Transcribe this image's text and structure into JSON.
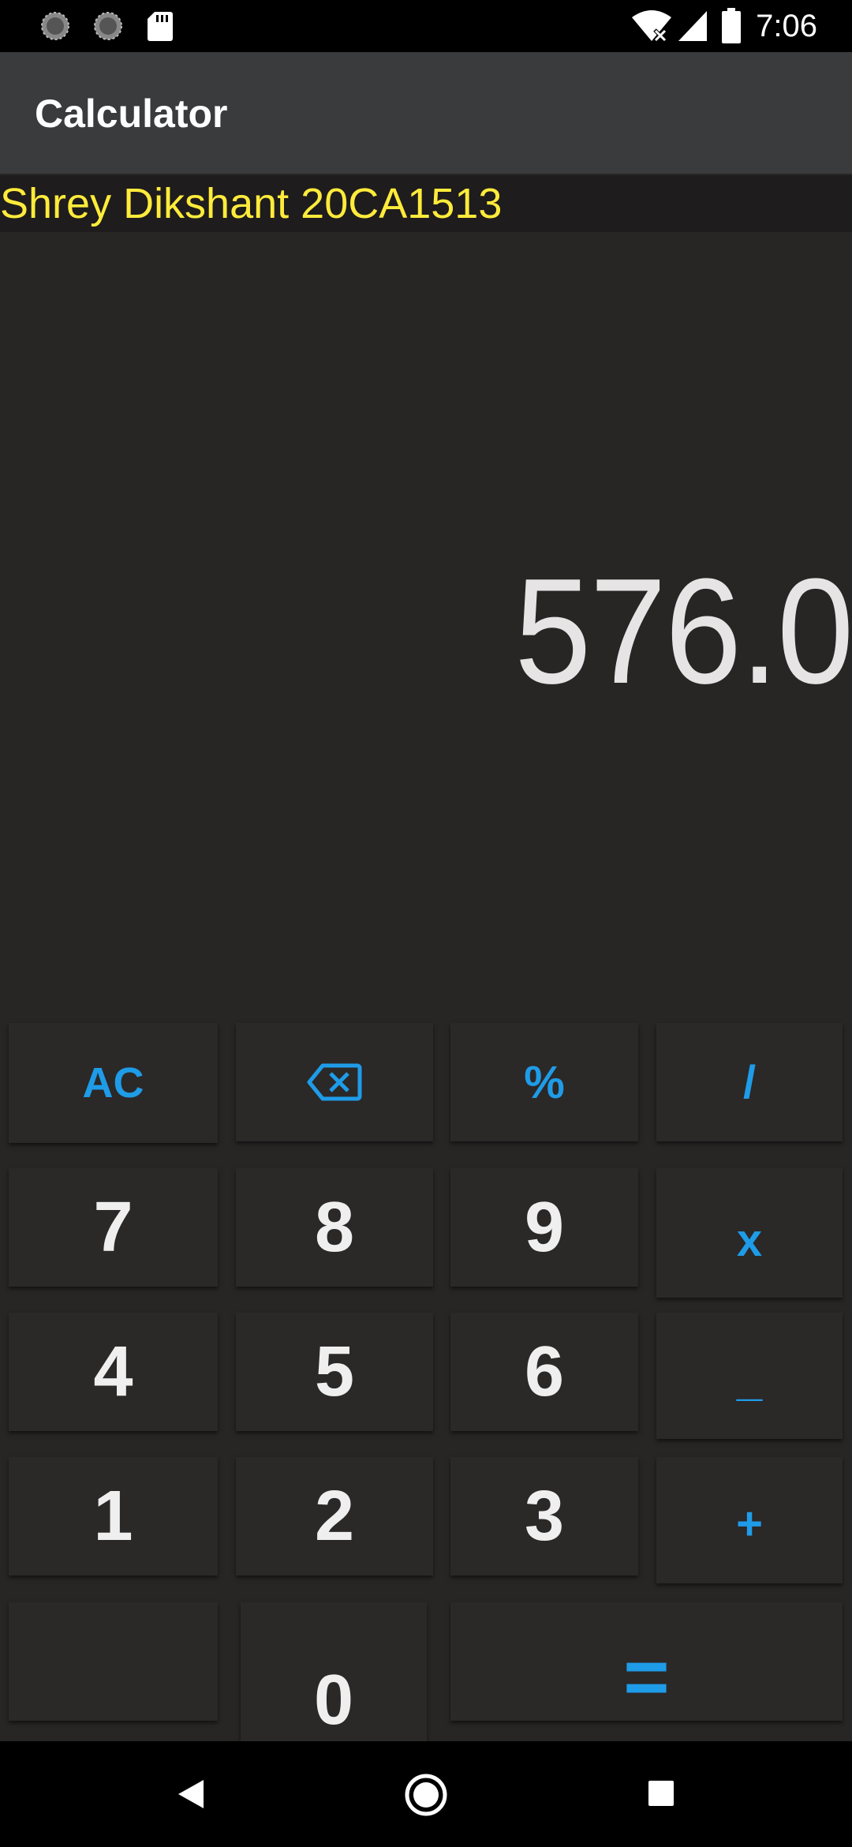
{
  "status_bar": {
    "time": "7:06",
    "icons": [
      "sync-icon",
      "sync-icon",
      "sd-card-icon",
      "wifi-off-icon",
      "signal-icon",
      "battery-icon"
    ]
  },
  "app_bar": {
    "title": "Calculator"
  },
  "header": {
    "name_text": "Shrey Dikshant 20CA1513"
  },
  "display": {
    "value": "576.0"
  },
  "keypad": {
    "row1": {
      "ac": "AC",
      "backspace_icon": "backspace-icon",
      "percent": "%",
      "divide": "/"
    },
    "row2": {
      "seven": "7",
      "eight": "8",
      "nine": "9",
      "multiply": "x"
    },
    "row3": {
      "four": "4",
      "five": "5",
      "six": "6",
      "minus": "_"
    },
    "row4": {
      "one": "1",
      "two": "2",
      "three": "3",
      "plus": "+"
    },
    "row5": {
      "dot": ".",
      "zero": "0",
      "equals": "="
    }
  },
  "colors": {
    "background": "#282525",
    "accent": "#1e9ce8",
    "name_text": "#ffeb3b",
    "app_bar": "#3a3b3d"
  },
  "nav_bar": {
    "icons": [
      "back-icon",
      "home-icon",
      "recents-icon"
    ]
  }
}
